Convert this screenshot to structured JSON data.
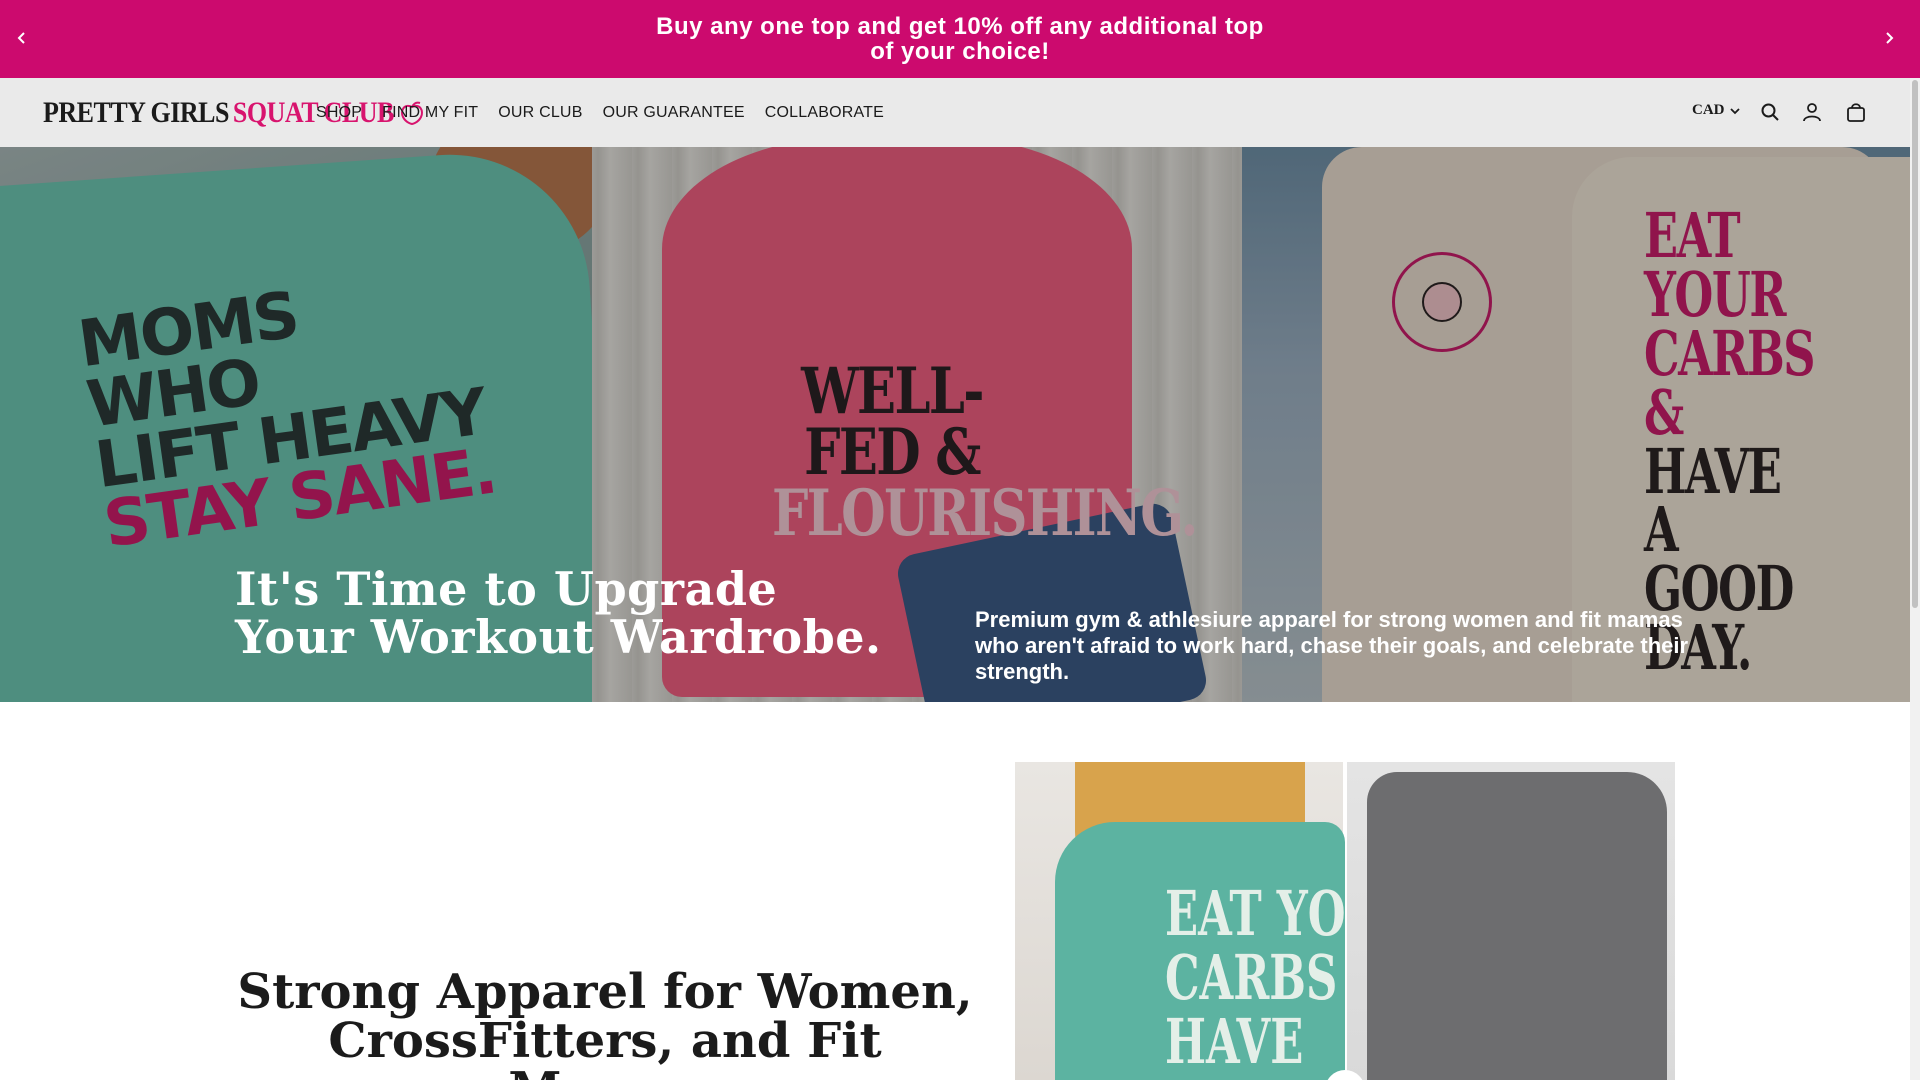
{
  "announcement": {
    "text": "Buy any one top and get 10% off any additional top of your choice!",
    "prev_icon": "chevron-left-icon",
    "next_icon": "chevron-right-icon",
    "bg_color": "#cc0a6e"
  },
  "header": {
    "logo": {
      "main": "PRETTY GIRLS",
      "accent": "SQUAT CLUB",
      "icon": "peach-icon"
    },
    "nav": [
      "SHOP",
      "FIND MY FIT",
      "OUR CLUB",
      "OUR GUARANTEE",
      "COLLABORATE"
    ],
    "currency": "CAD",
    "icons": [
      "search-icon",
      "account-icon",
      "cart-icon"
    ]
  },
  "hero": {
    "heading_line1": "It's Time to Upgrade",
    "heading_line2": "Your Workout Wardrobe.",
    "subtext": "Premium gym & athlesiure apparel for strong women and fit mamas who aren't afraid to work hard, chase their goals, and celebrate their strength.",
    "panel1": {
      "line1": "MOMS WHO",
      "line2": "LIFT HEAVY",
      "line3": "STAY SANE."
    },
    "panel2": {
      "line1": "WELL-FED &",
      "line2": "FLOURISHING."
    },
    "panel3": {
      "line1": "EAT YOUR",
      "line2": "CARBS &",
      "line3": "HAVE A",
      "line4": "GOOD DAY."
    }
  },
  "section": {
    "heading_line1": "Strong Apparel for Women,",
    "heading_line2": "CrossFitters, and Fit Mamas",
    "collage_shirt_text": "EAT YO CARBS HAVE"
  }
}
